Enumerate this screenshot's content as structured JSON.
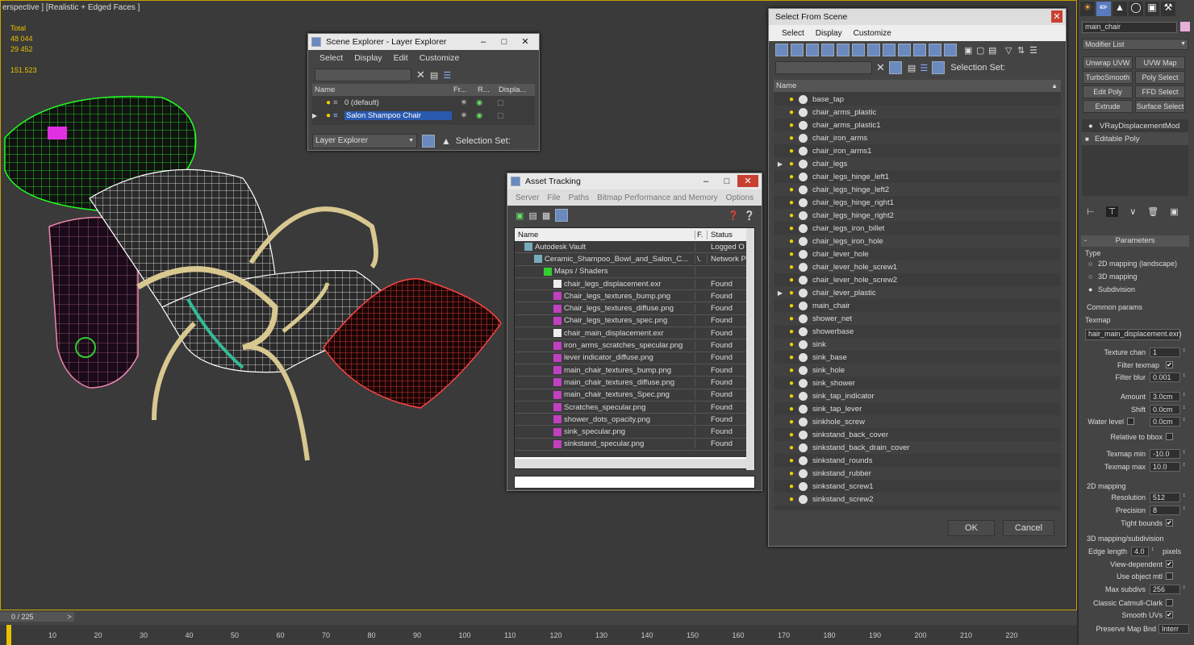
{
  "viewport": {
    "label": "erspective ] [Realistic + Edged Faces ]",
    "stats": {
      "total_label": "Total",
      "polys": "48 044",
      "verts": "29 452",
      "fps": "151.523"
    }
  },
  "scene_explorer": {
    "title": "Scene Explorer - Layer Explorer",
    "menu": [
      "Select",
      "Display",
      "Edit",
      "Customize"
    ],
    "columns": [
      "Name",
      "Fr...",
      "R...",
      "Displa..."
    ],
    "rows": [
      "0 (default)",
      "Salon Shampoo Chair"
    ],
    "footer_dropdown": "Layer Explorer",
    "selection_set": "Selection Set:"
  },
  "asset_tracking": {
    "title": "Asset Tracking",
    "menu": [
      "Server",
      "File",
      "Paths",
      "Bitmap Performance and Memory",
      "Options"
    ],
    "columns": [
      "Name",
      "F.",
      "Status"
    ],
    "rows": [
      {
        "name": "Autodesk Vault",
        "f": "",
        "status": "Logged O",
        "indent": 1
      },
      {
        "name": "Ceramic_Shampoo_Bowl_and_Salon_C...",
        "f": "\\.",
        "status": "Network P",
        "indent": 2
      },
      {
        "name": "Maps / Shaders",
        "f": "",
        "status": "",
        "indent": 3
      },
      {
        "name": "chair_legs_displacement.exr",
        "f": "",
        "status": "Found",
        "indent": 4
      },
      {
        "name": "Chair_legs_textures_bump.png",
        "f": "",
        "status": "Found",
        "indent": 4
      },
      {
        "name": "Chair_legs_textures_diffuse.png",
        "f": "",
        "status": "Found",
        "indent": 4
      },
      {
        "name": "Chair_legs_textures_spec.png",
        "f": "",
        "status": "Found",
        "indent": 4
      },
      {
        "name": "chair_main_displacement.exr",
        "f": "",
        "status": "Found",
        "indent": 4
      },
      {
        "name": "iron_arms_scratches_specular.png",
        "f": "",
        "status": "Found",
        "indent": 4
      },
      {
        "name": "lever indicator_diffuse.png",
        "f": "",
        "status": "Found",
        "indent": 4
      },
      {
        "name": "main_chair_textures_bump.png",
        "f": "",
        "status": "Found",
        "indent": 4
      },
      {
        "name": "main_chair_textures_diffuse.png",
        "f": "",
        "status": "Found",
        "indent": 4
      },
      {
        "name": "main_chair_textures_Spec.png",
        "f": "",
        "status": "Found",
        "indent": 4
      },
      {
        "name": "Scratches_specular.png",
        "f": "",
        "status": "Found",
        "indent": 4
      },
      {
        "name": "shower_dots_opacity.png",
        "f": "",
        "status": "Found",
        "indent": 4
      },
      {
        "name": "sink_specular.png",
        "f": "",
        "status": "Found",
        "indent": 4
      },
      {
        "name": "sinkstand_specular.png",
        "f": "",
        "status": "Found",
        "indent": 4
      }
    ]
  },
  "select_from_scene": {
    "title": "Select From Scene",
    "menu": [
      "Select",
      "Display",
      "Customize"
    ],
    "selection_set": "Selection Set:",
    "column": "Name",
    "items": [
      "base_tap",
      "chair_arms_plastic",
      "chair_arms_plastic1",
      "chair_iron_arms",
      "chair_iron_arms1",
      "chair_legs",
      "chair_legs_hinge_left1",
      "chair_legs_hinge_left2",
      "chair_legs_hinge_right1",
      "chair_legs_hinge_right2",
      "chair_legs_iron_billet",
      "chair_legs_iron_hole",
      "chair_lever_hole",
      "chair_lever_hole_screw1",
      "chair_lever_hole_screw2",
      "chair_lever_plastic",
      "main_chair",
      "shower_net",
      "showerbase",
      "sink",
      "sink_base",
      "sink_hole",
      "sink_shower",
      "sink_tap_indicator",
      "sink_tap_lever",
      "sinkhole_screw",
      "sinkstand_back_cover",
      "sinkstand_back_drain_cover",
      "sinkstand_rounds",
      "sinkstand_rubber",
      "sinkstand_screw1",
      "sinkstand_screw2"
    ],
    "ok": "OK",
    "cancel": "Cancel"
  },
  "right_panel": {
    "object_name": "main_chair",
    "modifier_list": "Modifier List",
    "buttons": [
      "Unwrap UVW",
      "UVW Map",
      "TurboSmooth",
      "Poly Select",
      "Edit Poly",
      "FFD Select",
      "Extrude",
      "Surface Select"
    ],
    "stack": [
      "VRayDisplacementMod",
      "Editable Poly"
    ],
    "parameters": {
      "title": "Parameters",
      "type_label": "Type",
      "types": [
        "2D mapping (landscape)",
        "3D mapping",
        "Subdivision"
      ],
      "common": "Common params",
      "texmap": "Texmap",
      "texmap_value": "hair_main_displacement.exr)",
      "texture_chan": "Texture chan",
      "texture_chan_value": "1",
      "filter_texmap": "Filter texmap",
      "filter_blur": "Filter blur",
      "filter_blur_value": "0.001",
      "amount": "Amount",
      "amount_value": "3.0cm",
      "shift": "Shift",
      "shift_value": "0.0cm",
      "water_level": "Water level",
      "water_level_value": "0.0cm",
      "relative": "Relative to bbox",
      "texmap_min": "Texmap min",
      "texmap_min_value": "-10.0",
      "texmap_max": "Texmap max",
      "texmap_max_value": "10.0",
      "mapping2d": "2D mapping",
      "resolution": "Resolution",
      "resolution_value": "512",
      "precision": "Precision",
      "precision_value": "8",
      "tight": "Tight bounds",
      "mapping3d": "3D mapping/subdivision",
      "edge_length": "Edge length",
      "edge_length_value": "4.0",
      "pixels": "pixels",
      "view_dep": "View-dependent",
      "use_obj": "Use object mtl",
      "max_subdivs": "Max subdivs",
      "max_subdivs_value": "256",
      "catmull": "Classic Catmull-Clark",
      "smooth_uvs": "Smooth UVs",
      "preserve": "Preserve Map Bnd",
      "preserve_value": "Interr"
    }
  },
  "timeline": {
    "frame": "0 / 225",
    "ticks": [
      "10",
      "20",
      "30",
      "40",
      "50",
      "60",
      "70",
      "80",
      "90",
      "100",
      "110",
      "120",
      "130",
      "140",
      "150",
      "160",
      "170",
      "180",
      "190",
      "200",
      "210",
      "220"
    ]
  }
}
